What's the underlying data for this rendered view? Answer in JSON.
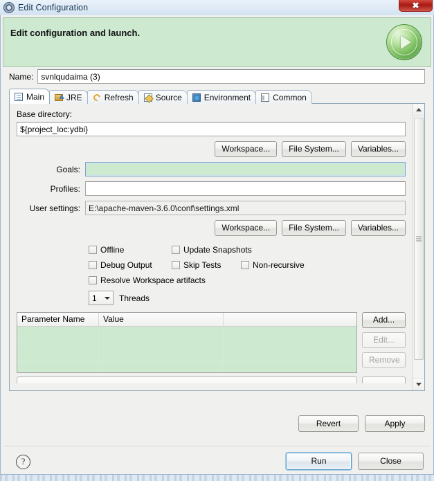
{
  "window": {
    "title": "Edit Configuration",
    "title_icon": "gear-icon",
    "close_label": "✖"
  },
  "banner": {
    "heading": "Edit configuration and launch.",
    "run_icon": "run-play-icon"
  },
  "name_field": {
    "label": "Name:",
    "value": "svnlqudaima (3)",
    "placeholder": ""
  },
  "tabs": [
    {
      "label": "Main",
      "icon": "main-doc-icon",
      "active": true
    },
    {
      "label": "JRE",
      "icon": "jre-icon",
      "active": false
    },
    {
      "label": "Refresh",
      "icon": "refresh-icon",
      "active": false
    },
    {
      "label": "Source",
      "icon": "source-icon",
      "active": false
    },
    {
      "label": "Environment",
      "icon": "environment-icon",
      "active": false
    },
    {
      "label": "Common",
      "icon": "common-icon",
      "active": false
    }
  ],
  "main_tab": {
    "base_directory": {
      "label": "Base directory:",
      "value": "${project_loc:ydbi}"
    },
    "path_buttons": [
      {
        "label": "Workspace..."
      },
      {
        "label": "File System..."
      },
      {
        "label": "Variables..."
      }
    ],
    "goals": {
      "label": "Goals:",
      "value": "",
      "focused": true
    },
    "profiles": {
      "label": "Profiles:",
      "value": ""
    },
    "user_settings": {
      "label": "User settings:",
      "value": "E:\\apache-maven-3.6.0\\conf\\settings.xml"
    },
    "settings_buttons": [
      {
        "label": "Workspace..."
      },
      {
        "label": "File System..."
      },
      {
        "label": "Variables..."
      }
    ],
    "checkboxes": [
      {
        "label": "Offline",
        "checked": false
      },
      {
        "label": "Update Snapshots",
        "checked": false
      },
      {
        "label": "Debug Output",
        "checked": false
      },
      {
        "label": "Skip Tests",
        "checked": false
      },
      {
        "label": "Non-recursive",
        "checked": false
      },
      {
        "label": "Resolve Workspace artifacts",
        "checked": false
      }
    ],
    "threads": {
      "value": "1",
      "label": "Threads"
    },
    "parameters_table": {
      "columns": [
        "Parameter Name",
        "Value",
        ""
      ],
      "rows": []
    },
    "table_buttons": [
      {
        "label": "Add...",
        "enabled": true
      },
      {
        "label": "Edit...",
        "enabled": false
      },
      {
        "label": "Remove",
        "enabled": false
      }
    ]
  },
  "dialog_buttons": {
    "revert": "Revert",
    "apply": "Apply"
  },
  "footer": {
    "help": "?",
    "run": "Run",
    "close": "Close"
  },
  "colors": {
    "banner_green": "#cde9d0",
    "accent_blue": "#5a9dc8",
    "close_red": "#c8392f",
    "run_green": "#4e9a3c"
  }
}
